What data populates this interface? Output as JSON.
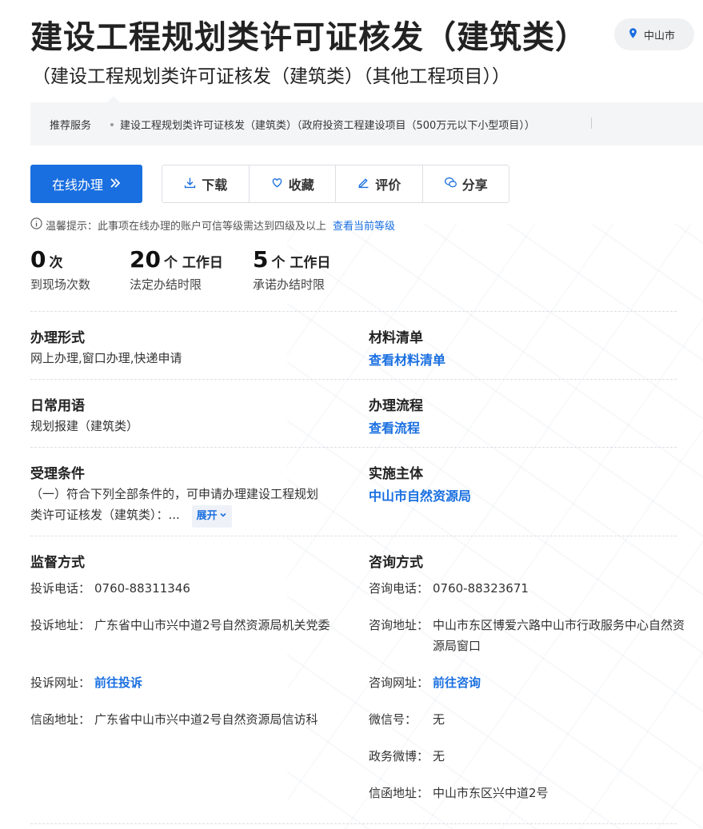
{
  "header": {
    "title": "建设工程规划类许可证核发（建筑类）",
    "subtitle": "（建设工程规划类许可证核发（建筑类）（其他工程项目））",
    "location": "中山市"
  },
  "recommend": {
    "label": "推荐服务",
    "items": [
      "建设工程规划类许可证核发（建筑类）（政府投资工程建设项目（500万元以下小型项目））"
    ]
  },
  "actions": {
    "online": "在线办理",
    "download": "下载",
    "favorite": "收藏",
    "review": "评价",
    "share": "分享"
  },
  "tip": {
    "text": "温馨提示：此事项在线办理的账户可信等级需达到四级及以上",
    "link": "查看当前等级"
  },
  "stats": [
    {
      "num": "0",
      "unit": "次",
      "label": "到现场次数"
    },
    {
      "num": "20",
      "unit": "个 工作日",
      "label": "法定办结时限"
    },
    {
      "num": "5",
      "unit": "个 工作日",
      "label": "承诺办结时限"
    }
  ],
  "info": {
    "mode": {
      "title": "办理形式",
      "value": "网上办理,窗口办理,快递申请"
    },
    "materials": {
      "title": "材料清单",
      "link": "查看材料清单"
    },
    "common": {
      "title": "日常用语",
      "value": "规划报建（建筑类）"
    },
    "process": {
      "title": "办理流程",
      "link": "查看流程"
    },
    "conditions": {
      "title": "受理条件",
      "line1": "（一）符合下列全部条件的，可申请办理建设工程规划",
      "line2": "类许可证核发（建筑类）：...",
      "expand": "展开"
    },
    "subject": {
      "title": "实施主体",
      "link": "中山市自然资源局"
    }
  },
  "supervision": {
    "title": "监督方式",
    "phone_label": "投诉电话：",
    "phone": "0760-88311346",
    "address_label": "投诉地址：",
    "address": "广东省中山市兴中道2号自然资源局机关党委",
    "web_label": "投诉网址：",
    "web": "前往投诉",
    "letter_label": "信函地址：",
    "letter": "广东省中山市兴中道2号自然资源局信访科"
  },
  "consult": {
    "title": "咨询方式",
    "phone_label": "咨询电话：",
    "phone": "0760-88323671",
    "address_label": "咨询地址：",
    "address": "中山市东区博爱六路中山市行政服务中心自然资源局窗口",
    "web_label": "咨询网址：",
    "web": "前往咨询",
    "wechat_label": "微信号：",
    "wechat": "无",
    "weibo_label": "政务微博：",
    "weibo": "无",
    "letter_label": "信函地址：",
    "letter": "中山市东区兴中道2号"
  },
  "colors": {
    "accent": "#1a6fe0",
    "bar": "#f4f5f7"
  }
}
